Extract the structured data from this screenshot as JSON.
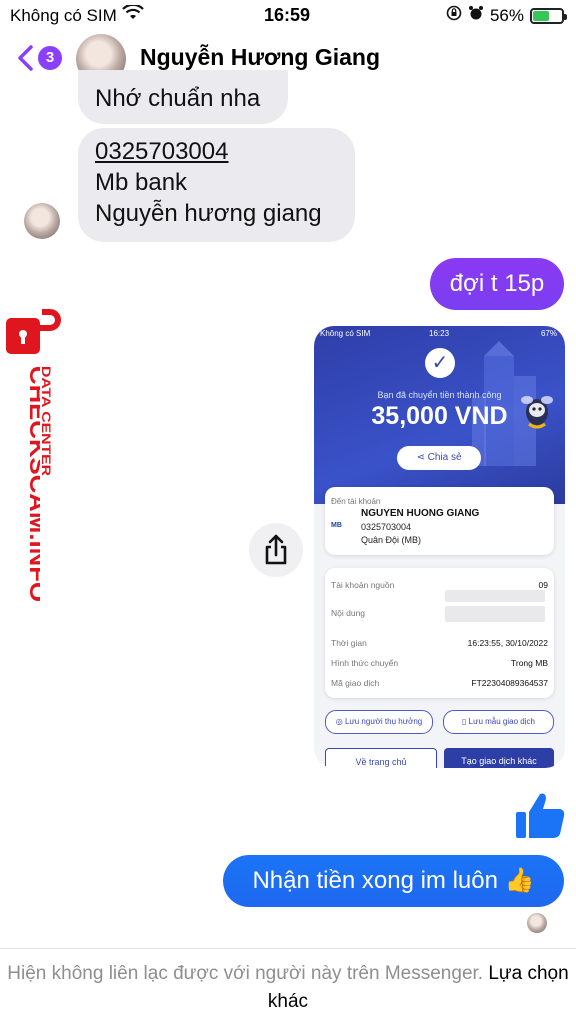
{
  "status_bar": {
    "carrier": "Không có SIM",
    "time": "16:59",
    "battery": "56%",
    "battery_level": 0.56
  },
  "header": {
    "back_count": "3",
    "name": "Nguyễn Hương Giang"
  },
  "messages": {
    "incoming_1": "Nhớ chuẩn nha",
    "incoming_2": {
      "phone": "0325703004",
      "bank": "Mb bank",
      "name": "Nguyễn hương giang"
    },
    "outgoing_1": "đợi t 15p",
    "outgoing_2": "Nhận tiền xong im luôn 👍"
  },
  "receipt": {
    "status_carrier": "Không có SIM",
    "status_time": "16:23",
    "status_battery": "67%",
    "success_text": "Bạn đã chuyển tiền thành công",
    "amount": "35,000 VND",
    "share_label": "Chia sẻ",
    "to_label": "Đến tài khoản",
    "recipient_name": "NGUYEN HUONG GIANG",
    "recipient_account": "0325703004",
    "recipient_bank": "Quân Đội (MB)",
    "bank_logo": "MB",
    "rows": [
      {
        "label": "Tài khoản nguồn",
        "value": "09"
      },
      {
        "label": "Nội dung",
        "value": ""
      },
      {
        "label": "Thời gian",
        "value": "16:23:55, 30/10/2022"
      },
      {
        "label": "Hình thức chuyển",
        "value": "Trong MB"
      },
      {
        "label": "Mã giao dịch",
        "value": "FT22304089364537"
      }
    ],
    "save_recipient": "Lưu người thụ hưởng",
    "save_template": "Lưu mẫu giao dịch",
    "home_button": "Về trang chủ",
    "new_tx_button": "Tạo giao dịch khác"
  },
  "footer": {
    "text": "Hiện không liên lạc được với người này trên Messenger.",
    "link": "Lựa chọn khác"
  },
  "watermark": {
    "main": "CHECKSCAM.INFO",
    "sub": "DATA CENTER"
  },
  "colors": {
    "accent": "#8a3ffc",
    "outgoing_blue": "#1b74f5",
    "watermark_red": "#e0161f",
    "receipt_blue": "#2f3ea8"
  }
}
